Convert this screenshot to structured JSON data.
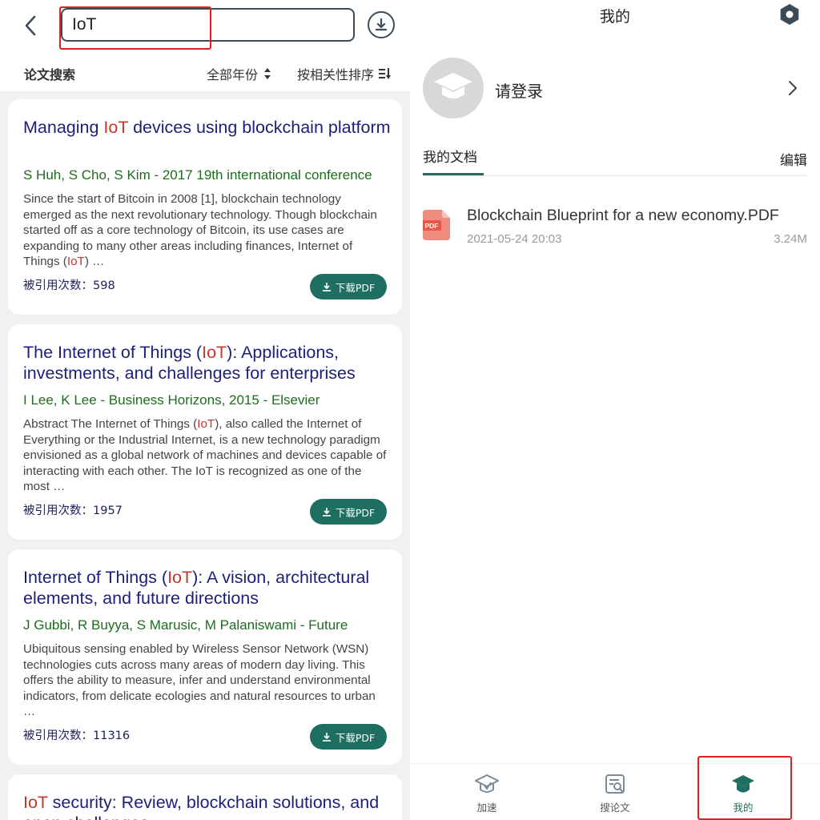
{
  "search": {
    "query": "IoT",
    "placeholder": ""
  },
  "filter": {
    "title": "论文搜索",
    "year": "全部年份",
    "sort": "按相关性排序"
  },
  "results": [
    {
      "title_parts": [
        "Managing ",
        "IoT",
        " devices using blockchain platform"
      ],
      "authors": "S Huh, S Cho, S Kim - 2017 19th international conference",
      "abstract_parts": [
        "Since the start of Bitcoin in 2008 [1], blockchain technology emerged as the next revolutionary technology. Though blockchain started off as a core technology of Bitcoin, its use cases are expanding to many other areas including finances, Internet of Things (",
        "IoT",
        ") …"
      ],
      "cite_label": "被引用次数：",
      "cite_count": "598",
      "download_label": "下载PDF"
    },
    {
      "title_parts": [
        "The Internet of Things (",
        "IoT",
        "): Applications, investments, and challenges for enterprises"
      ],
      "authors": "I Lee, K Lee - Business Horizons, 2015 - Elsevier",
      "abstract_parts": [
        "Abstract The Internet of Things (",
        "IoT",
        "), also called the Internet of Everything or the Industrial Internet, is a new technology paradigm envisioned as a global network of machines and devices capable of interacting with each other. The IoT is recognized as one of the most …"
      ],
      "cite_label": "被引用次数：",
      "cite_count": "1957",
      "download_label": "下载PDF"
    },
    {
      "title_parts": [
        "Internet of Things (",
        "IoT",
        "): A vision, architectural elements, and future directions"
      ],
      "authors": "J Gubbi, R Buyya, S Marusic, M Palaniswami - Future",
      "abstract_parts": [
        "Ubiquitous sensing enabled by Wireless Sensor Network (WSN) technologies cuts across many areas of modern day living. This offers the ability to measure, infer and understand environmental indicators, from delicate ecologies and natural resources to urban …",
        "",
        ""
      ],
      "cite_label": "被引用次数：",
      "cite_count": "11316",
      "download_label": "下载PDF"
    },
    {
      "title_parts": [
        "",
        "IoT",
        " security: Review, blockchain solutions, and open challenges"
      ],
      "authors": "",
      "abstract_parts": [
        "",
        "",
        ""
      ],
      "cite_label": "",
      "cite_count": "",
      "download_label": ""
    }
  ],
  "profile": {
    "page_title": "我的",
    "login_prompt": "请登录",
    "docs_tab": "我的文档",
    "edit_label": "编辑",
    "documents": [
      {
        "name": "Blockchain Blueprint for a new economy.PDF",
        "date": "2021-05-24 20:03",
        "size": "3.24M",
        "icon_label": "PDF"
      }
    ]
  },
  "nav": {
    "items": [
      {
        "label": "加速",
        "icon": "rocket-cap-icon",
        "active": false
      },
      {
        "label": "搜论文",
        "icon": "search-doc-icon",
        "active": false
      },
      {
        "label": "我的",
        "icon": "graduation-cap-icon",
        "active": true
      }
    ]
  },
  "colors": {
    "accent": "#1f6e62",
    "title": "#1c1f7a",
    "highlight": "#c0392b",
    "authors": "#1f6b1f",
    "annotation": "#e02020"
  }
}
